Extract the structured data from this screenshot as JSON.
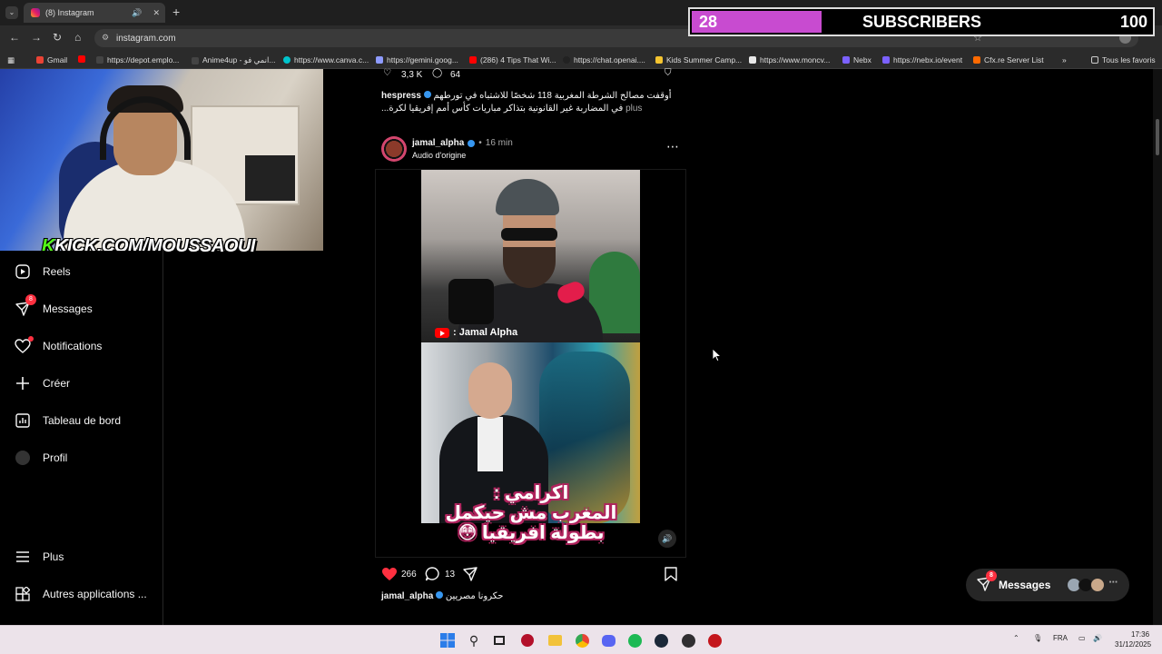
{
  "browser": {
    "tab_title": "(8) Instagram",
    "url": "instagram.com",
    "bookmarks": [
      {
        "label": "Gmail",
        "color": "#ea4335"
      },
      {
        "label": "",
        "color": "#ff0000"
      },
      {
        "label": "https://depot.emplo...",
        "color": "#444444"
      },
      {
        "label": "Anime4up - انمي فو...",
        "color": "#444444"
      },
      {
        "label": "https://www.canva.c...",
        "color": "#00c4cc"
      },
      {
        "label": "https://gemini.goog...",
        "color": "#8e9bff"
      },
      {
        "label": "(286) 4 Tips That Wi...",
        "color": "#ff0000"
      },
      {
        "label": "https://chat.openai....",
        "color": "#222222"
      },
      {
        "label": "Kids Summer Camp...",
        "color": "#f4c430"
      },
      {
        "label": "https://www.moncv...",
        "color": "#e8e8e8"
      },
      {
        "label": "Nebx",
        "color": "#7b61ff"
      },
      {
        "label": "https://nebx.io/event",
        "color": "#7b61ff"
      },
      {
        "label": "Cfx.re Server List",
        "color": "#ff6a00"
      }
    ],
    "bookmarks_more": "»",
    "all_bookmarks": "Tous les favoris"
  },
  "overlay": {
    "subscriber_count": "28",
    "subscriber_label": "SUBSCRIBERS",
    "subscriber_goal": "100",
    "progress": 0.28,
    "fill_color": "#c84bd0"
  },
  "webcam": {
    "kick_letter": "K",
    "kick_text": "KICK.COM/MOUSSAOUI"
  },
  "sidebar": {
    "items": [
      {
        "label": "Reels",
        "icon": "reels-icon"
      },
      {
        "label": "Messages",
        "icon": "messages-icon",
        "badge": "8"
      },
      {
        "label": "Notifications",
        "icon": "heart-icon"
      },
      {
        "label": "Créer",
        "icon": "plus-icon"
      },
      {
        "label": "Tableau de bord",
        "icon": "dashboard-icon"
      },
      {
        "label": "Profil",
        "icon": "avatar"
      }
    ],
    "bottom_items": [
      {
        "label": "Plus",
        "icon": "menu-icon"
      },
      {
        "label": "Autres applications ...",
        "icon": "apps-icon"
      }
    ]
  },
  "previous_post": {
    "likes": "3,3 K",
    "comments": "64",
    "username": "hespress",
    "caption": "أوقفت مصالح الشرطة المغربية 118 شخصًا للاشتباه في تورطهم في المضاربة غير القانونية بتذاكر مباريات كأس أمم إفريقيا لكرة...",
    "more": "plus"
  },
  "post": {
    "username": "jamal_alpha",
    "time": "16 min",
    "audio": "Audio d'origine",
    "source_label": ": Jamal Alpha",
    "overlay_caption_line1": "اكرامي :",
    "overlay_caption_line2": "المغرب مش حيكمل",
    "overlay_caption_line3": "بطولة افريقيا 😳",
    "likes": "266",
    "comments": "13",
    "caption_username": "jamal_alpha",
    "caption": "حكرونا مصريين"
  },
  "floating_messages": {
    "label": "Messages",
    "badge": "8"
  },
  "taskbar": {
    "language": "FRA",
    "time": "17:36",
    "date": "31/12/2025"
  }
}
